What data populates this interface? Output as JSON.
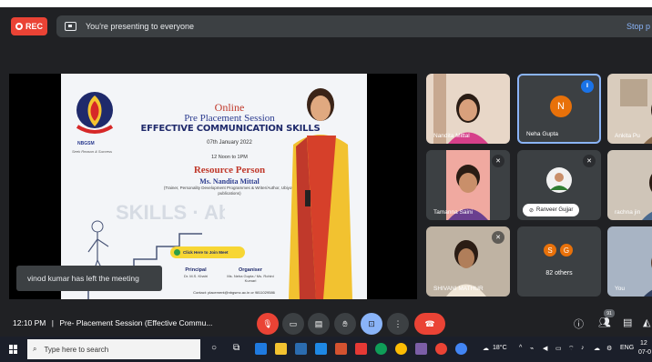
{
  "meet": {
    "rec_label": "REC",
    "presenting_text": "You're presenting to everyone",
    "stop_label": "Stop p",
    "toast": "vinod kumar has left the meeting"
  },
  "poster": {
    "logo_text": "NBGSM",
    "tagline": "Seek Reason & Success",
    "online": "Online",
    "session": "Pre Placement Session",
    "title": "EFFECTIVE COMMUNICATION SKILLS",
    "date": "07th January 2022",
    "time": "12 Noon to 1PM",
    "resource_person": "Resource Person",
    "speaker_name": "Ms. Nandita Mittal",
    "speaker_desc": "(Trainer, Personality Development Programmes & Writer/Author, Ubiyoto publications)",
    "join_button": "Click Here to Join Meet",
    "principal_label": "Principal",
    "principal_name": "Dr. M.S. Khatri",
    "organiser_label": "Organiser",
    "organiser_names": "Ms. Neha Gupta / Ms. Rohini Kumari",
    "contact": "Contact: placement@nbgsmc.ac.in or 9811029586",
    "bg_words": "SKILLS · Ability"
  },
  "participants": [
    {
      "name": "Nandita Mittal"
    },
    {
      "name": "Neha Gupta",
      "initial": "N"
    },
    {
      "name": "Ankita Pu"
    },
    {
      "name": "Tamanna Saini"
    },
    {
      "name": "Ranveer Gujjar"
    },
    {
      "name": "rachna jin"
    },
    {
      "name": "SHIVANI MATHUR"
    },
    {
      "name": "82 others",
      "initials": [
        "S",
        "G"
      ]
    },
    {
      "name": "You"
    }
  ],
  "controls": {
    "time": "12:10 PM",
    "separator": "|",
    "meeting_title": "Pre- Placement Session (Effective Commu...",
    "participant_count": "91"
  },
  "taskbar": {
    "search_placeholder": "Type here to search",
    "temperature": "18°C",
    "lang": "ENG",
    "clock_time": "12",
    "clock_date": "07-0"
  },
  "colors": {
    "meet_bg": "#202124",
    "tile_bg": "#3c4043",
    "danger": "#ea4335",
    "accent": "#8ab4f8",
    "avatar_orange": "#e8710a"
  }
}
